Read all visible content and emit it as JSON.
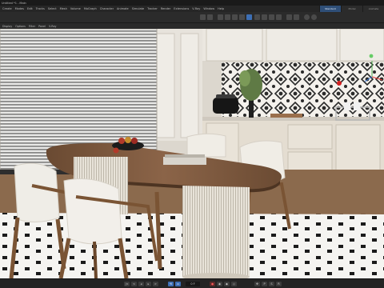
{
  "window": {
    "title": "Untitled *1 - Main"
  },
  "menu": [
    "Create",
    "Modes",
    "Edit",
    "Tracks",
    "Select",
    "Mesh",
    "Volume",
    "MoGraph",
    "Character",
    "Animate",
    "Simulate",
    "Tracker",
    "Render",
    "Extensions",
    "V-Ray",
    "Window",
    "Help"
  ],
  "layouts": [
    "Standard",
    "Model",
    "Animate"
  ],
  "viewport_menu": [
    "Display",
    "Options",
    "Filter",
    "Panel",
    "V-Ray"
  ],
  "timeline": {
    "current_frame": "0 F"
  },
  "icons": {
    "undo": "undo-icon",
    "redo": "redo-icon",
    "move": "move-icon",
    "rotate": "rotate-icon",
    "scale": "scale-icon",
    "render": "render-icon",
    "play": "play-icon",
    "record": "record-icon",
    "keyframe": "keyframe-icon"
  },
  "colors": {
    "accent": "#3d6fb5",
    "record": "#ff5a5a",
    "ui_bg": "#2b2b2b"
  }
}
